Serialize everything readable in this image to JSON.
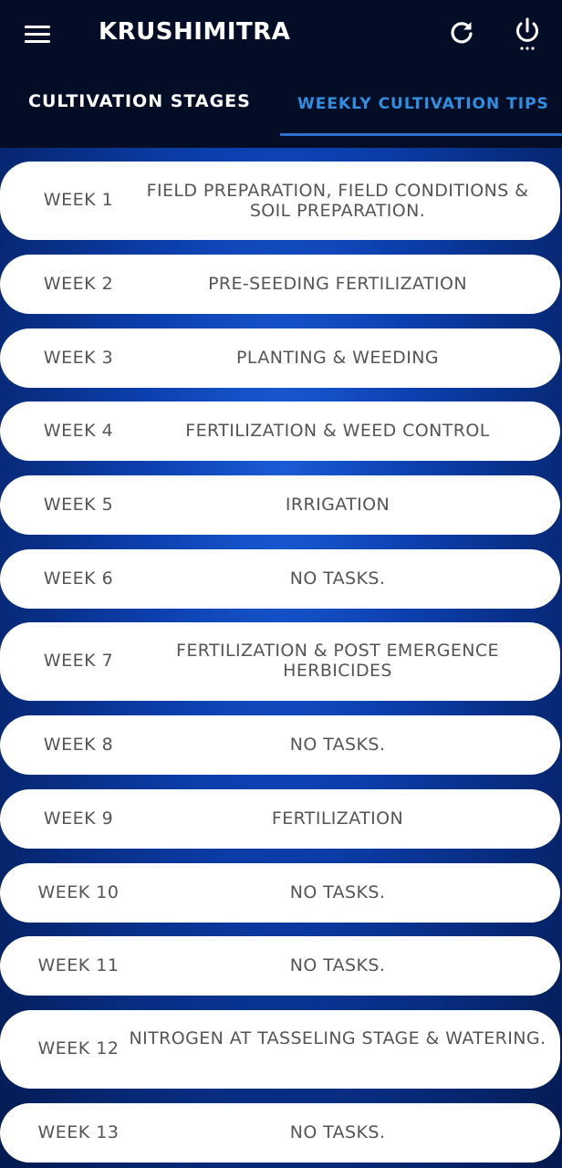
{
  "app": {
    "title": "KRUSHIMITRA"
  },
  "tabs": [
    {
      "label": "CULTIVATION STAGES",
      "active": false
    },
    {
      "label": "WEEKLY CULTIVATION TIPS",
      "active": true
    }
  ],
  "colors": {
    "header_bg": "#040d26",
    "active_tab": "#2f8fe0",
    "card_bg": "#ffffff",
    "card_text": "#555555",
    "background": "#0c3fae"
  },
  "icons": {
    "menu": "menu-icon",
    "refresh": "refresh-icon",
    "power": "power-icon"
  },
  "weeks": [
    {
      "week": "WEEK 1",
      "task": "FIELD PREPARATION, FIELD CONDITIONS & SOIL PREPARATION."
    },
    {
      "week": "WEEK 2",
      "task": "PRE-SEEDING FERTILIZATION"
    },
    {
      "week": "WEEK 3",
      "task": "PLANTING & WEEDING"
    },
    {
      "week": "WEEK 4",
      "task": "FERTILIZATION & WEED CONTROL"
    },
    {
      "week": "WEEK 5",
      "task": "IRRIGATION"
    },
    {
      "week": "WEEK 6",
      "task": "NO TASKS."
    },
    {
      "week": "WEEK 7",
      "task": "FERTILIZATION & POST EMERGENCE HERBICIDES"
    },
    {
      "week": "WEEK 8",
      "task": "NO TASKS."
    },
    {
      "week": "WEEK 9",
      "task": "FERTILIZATION"
    },
    {
      "week": "WEEK 10",
      "task": "NO TASKS."
    },
    {
      "week": "WEEK 11",
      "task": "NO TASKS."
    },
    {
      "week": "WEEK 12",
      "task": "NITROGEN AT TASSELING STAGE & WATERING."
    },
    {
      "week": "WEEK 13",
      "task": "NO TASKS."
    }
  ]
}
